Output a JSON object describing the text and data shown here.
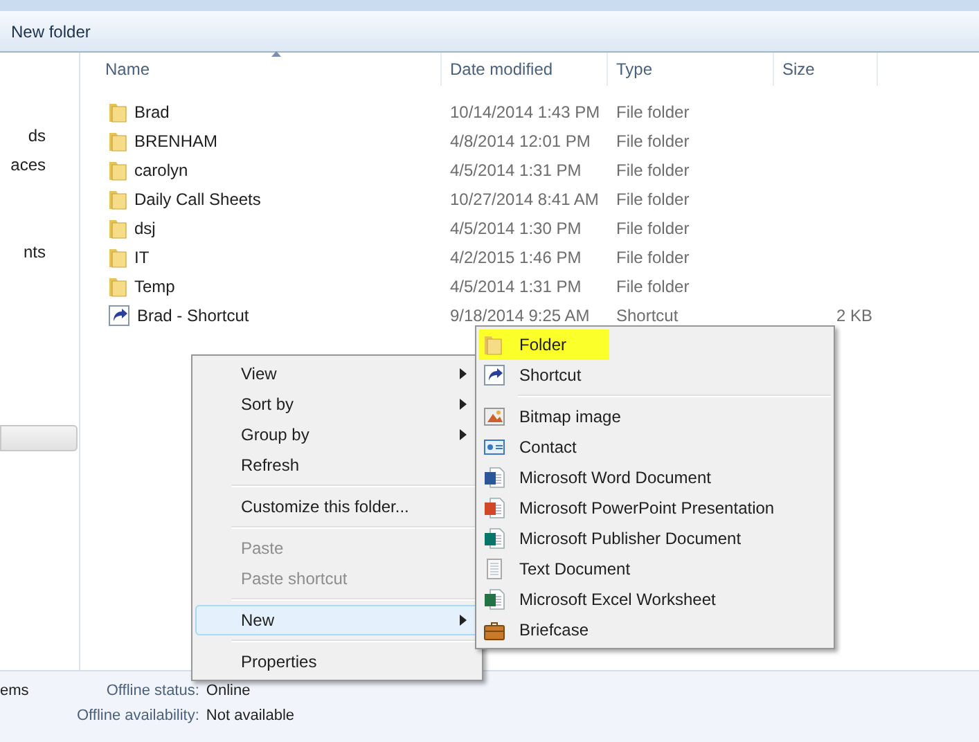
{
  "toolbar": {
    "new_folder": "New folder"
  },
  "sidebar": {
    "items": [
      {
        "label": "ds"
      },
      {
        "label": "aces"
      },
      {
        "label": "nts"
      }
    ]
  },
  "table": {
    "columns": [
      "Name",
      "Date modified",
      "Type",
      "Size"
    ],
    "rows": [
      {
        "kind": "folder",
        "name": "Brad",
        "date": "10/14/2014 1:43 PM",
        "type": "File folder",
        "size": ""
      },
      {
        "kind": "folder",
        "name": "BRENHAM",
        "date": "4/8/2014 12:01 PM",
        "type": "File folder",
        "size": ""
      },
      {
        "kind": "folder",
        "name": "carolyn",
        "date": "4/5/2014 1:31 PM",
        "type": "File folder",
        "size": ""
      },
      {
        "kind": "folder",
        "name": "Daily Call Sheets",
        "date": "10/27/2014 8:41 AM",
        "type": "File folder",
        "size": ""
      },
      {
        "kind": "folder",
        "name": "dsj",
        "date": "4/5/2014 1:30 PM",
        "type": "File folder",
        "size": ""
      },
      {
        "kind": "folder",
        "name": "IT",
        "date": "4/2/2015 1:46 PM",
        "type": "File folder",
        "size": ""
      },
      {
        "kind": "folder",
        "name": "Temp",
        "date": "4/5/2014 1:31 PM",
        "type": "File folder",
        "size": ""
      },
      {
        "kind": "shortcut",
        "name": "Brad - Shortcut",
        "date": "9/18/2014 9:25 AM",
        "type": "Shortcut",
        "size": "2 KB"
      }
    ]
  },
  "context_menu": {
    "items": [
      {
        "kind": "item",
        "label": "View",
        "submenu": true,
        "disabled": false,
        "selected": false
      },
      {
        "kind": "item",
        "label": "Sort by",
        "submenu": true,
        "disabled": false,
        "selected": false
      },
      {
        "kind": "item",
        "label": "Group by",
        "submenu": true,
        "disabled": false,
        "selected": false
      },
      {
        "kind": "item",
        "label": "Refresh",
        "submenu": false,
        "disabled": false,
        "selected": false
      },
      {
        "kind": "separator"
      },
      {
        "kind": "item",
        "label": "Customize this folder...",
        "submenu": false,
        "disabled": false,
        "selected": false
      },
      {
        "kind": "separator"
      },
      {
        "kind": "item",
        "label": "Paste",
        "submenu": false,
        "disabled": true,
        "selected": false
      },
      {
        "kind": "item",
        "label": "Paste shortcut",
        "submenu": false,
        "disabled": true,
        "selected": false
      },
      {
        "kind": "separator"
      },
      {
        "kind": "item",
        "label": "New",
        "submenu": true,
        "disabled": false,
        "selected": true
      },
      {
        "kind": "separator"
      },
      {
        "kind": "item",
        "label": "Properties",
        "submenu": false,
        "disabled": false,
        "selected": false
      }
    ]
  },
  "new_submenu": {
    "items": [
      {
        "kind": "folder",
        "label": "Folder",
        "highlighted": true
      },
      {
        "kind": "shortcut",
        "label": "Shortcut",
        "highlighted": false
      },
      {
        "kind": "separator"
      },
      {
        "kind": "bitmap",
        "label": "Bitmap image",
        "highlighted": false
      },
      {
        "kind": "contact",
        "label": "Contact",
        "highlighted": false
      },
      {
        "kind": "word",
        "label": "Microsoft Word Document",
        "highlighted": false
      },
      {
        "kind": "powerpoint",
        "label": "Microsoft PowerPoint Presentation",
        "highlighted": false
      },
      {
        "kind": "publisher",
        "label": "Microsoft Publisher Document",
        "highlighted": false
      },
      {
        "kind": "text",
        "label": "Text Document",
        "highlighted": false
      },
      {
        "kind": "excel",
        "label": "Microsoft Excel Worksheet",
        "highlighted": false
      },
      {
        "kind": "briefcase",
        "label": "Briefcase",
        "highlighted": false
      }
    ]
  },
  "status_bar": {
    "items_fragment": "ems",
    "fields": [
      {
        "label": "Offline status:",
        "value": "Online"
      },
      {
        "label": "Offline availability:",
        "value": "Not available"
      }
    ]
  }
}
